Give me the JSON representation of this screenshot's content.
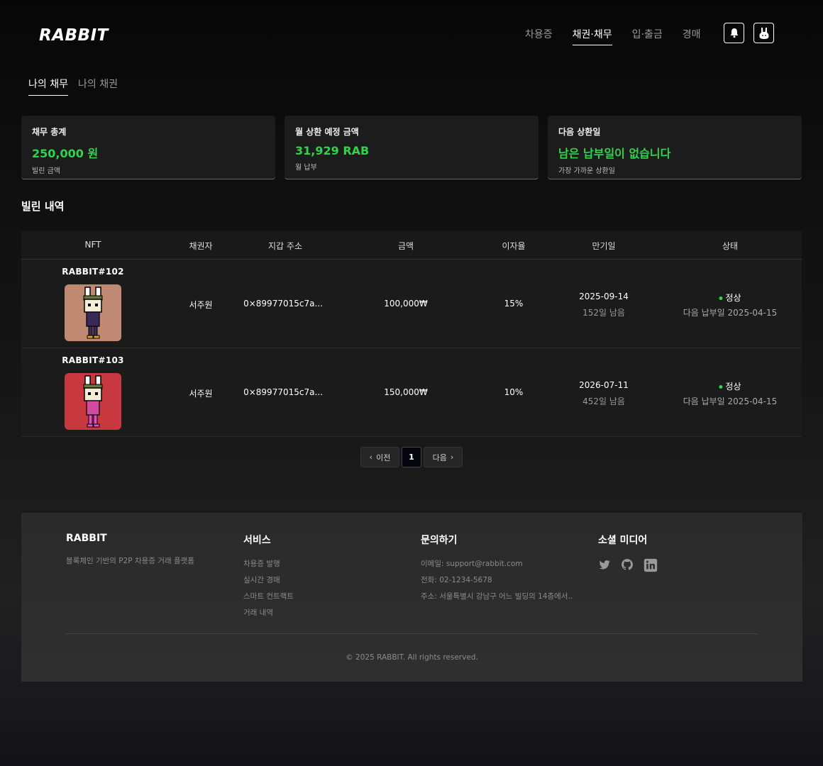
{
  "header": {
    "logo": "RABBIT",
    "nav": [
      "차용증",
      "채권·채무",
      "입·출금",
      "경매"
    ],
    "active_nav": "채권·채무"
  },
  "tabs": [
    "나의 채무",
    "나의 채권"
  ],
  "summary": [
    {
      "title": "채무 총계",
      "value": "250,000 원",
      "sub": "빌린 금액"
    },
    {
      "title": "월 상환 예정 금액",
      "value": "31,929 RAB",
      "sub": "월 납부"
    },
    {
      "title": "다음 상환일",
      "value": "남은 납부일이 없습니다",
      "sub": "가장 가까운 상환일"
    }
  ],
  "section_title": "빌린 내역",
  "table": {
    "columns": [
      "NFT",
      "채권자",
      "지갑 주소",
      "금액",
      "이자율",
      "만기일",
      "상태"
    ],
    "rows": [
      {
        "nft": "RABBIT#102",
        "creditor": "서주원",
        "wallet": "0×89977015c7a...",
        "amount": "100,000₩",
        "rate": "15%",
        "due": "2025-09-14",
        "remaining": "152일 남음",
        "status": "정상",
        "next_payment": "다음 납부일 2025-04-15",
        "bg_color": "#c08a72",
        "outfit_color": "#3a2a5a"
      },
      {
        "nft": "RABBIT#103",
        "creditor": "서주원",
        "wallet": "0×89977015c7a...",
        "amount": "150,000₩",
        "rate": "10%",
        "due": "2026-07-11",
        "remaining": "452일 남음",
        "status": "정상",
        "next_payment": "다음 납부일 2025-04-15",
        "bg_color": "#c8383f",
        "outfit_color": "#d04aa0"
      }
    ]
  },
  "pagination": {
    "prev": "이전",
    "current": "1",
    "next": "다음"
  },
  "footer": {
    "brand": "RABBIT",
    "brand_desc": "블록체인 기반의 P2P 차용증 거래 플랫폼",
    "service_title": "서비스",
    "services": [
      "차용증 발행",
      "실시간 경매",
      "스마트 컨트랙트",
      "거래 내역"
    ],
    "contact_title": "문의하기",
    "contacts": [
      "이메일: support@rabbit.com",
      "전화: 02-1234-5678",
      "주소: 서울특별시 강남구 어느 빌딩의 14층에서.."
    ],
    "social_title": "소셜 미디어",
    "social_icons": [
      "twitter-icon",
      "github-icon",
      "linkedin-icon"
    ],
    "copyright": "© 2025 RABBIT. All rights reserved."
  },
  "colors": {
    "accent_green": "#2fd44c"
  }
}
